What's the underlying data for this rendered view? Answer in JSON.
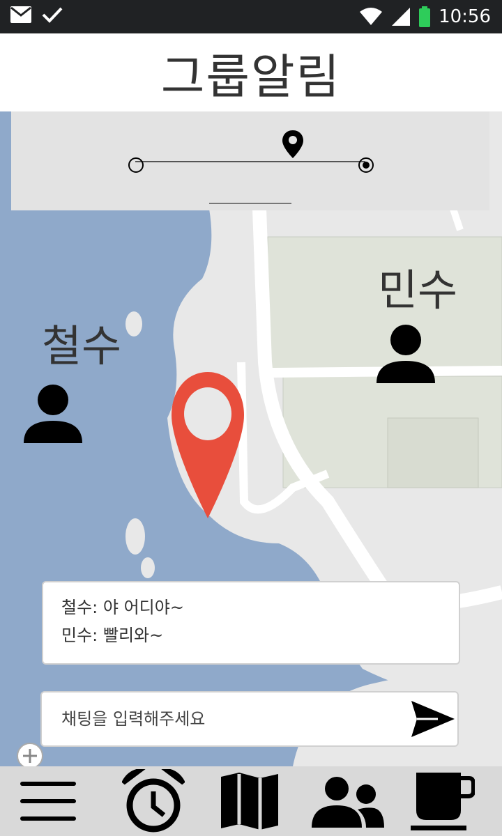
{
  "status_bar": {
    "time": "10:56",
    "icons": [
      "mail-icon",
      "check-icon",
      "wifi-icon",
      "signal-icon",
      "battery-icon"
    ],
    "battery_color": "#2ecc5a"
  },
  "app": {
    "title": "그룹알림"
  },
  "slider": {
    "handle_icon": "location-pin-icon"
  },
  "map": {
    "water_color": "#8fa9ca",
    "land_color": "#e8e8e8",
    "building_color": "#dfe3d9",
    "road_color": "#ffffff",
    "pin_color": "#e84e3c"
  },
  "people": [
    {
      "name": "철수",
      "icon": "person-icon"
    },
    {
      "name": "민수",
      "icon": "person-icon"
    }
  ],
  "chat": {
    "messages": [
      "철수: 야 어디야~",
      "민수: 빨리와~"
    ],
    "input_placeholder": "채팅을 입력해주세요",
    "send_icon": "send-icon"
  },
  "bottom_nav": {
    "items": [
      "menu-icon",
      "alarm-clock-icon",
      "map-icon",
      "group-icon",
      "coffee-cup-icon"
    ]
  }
}
